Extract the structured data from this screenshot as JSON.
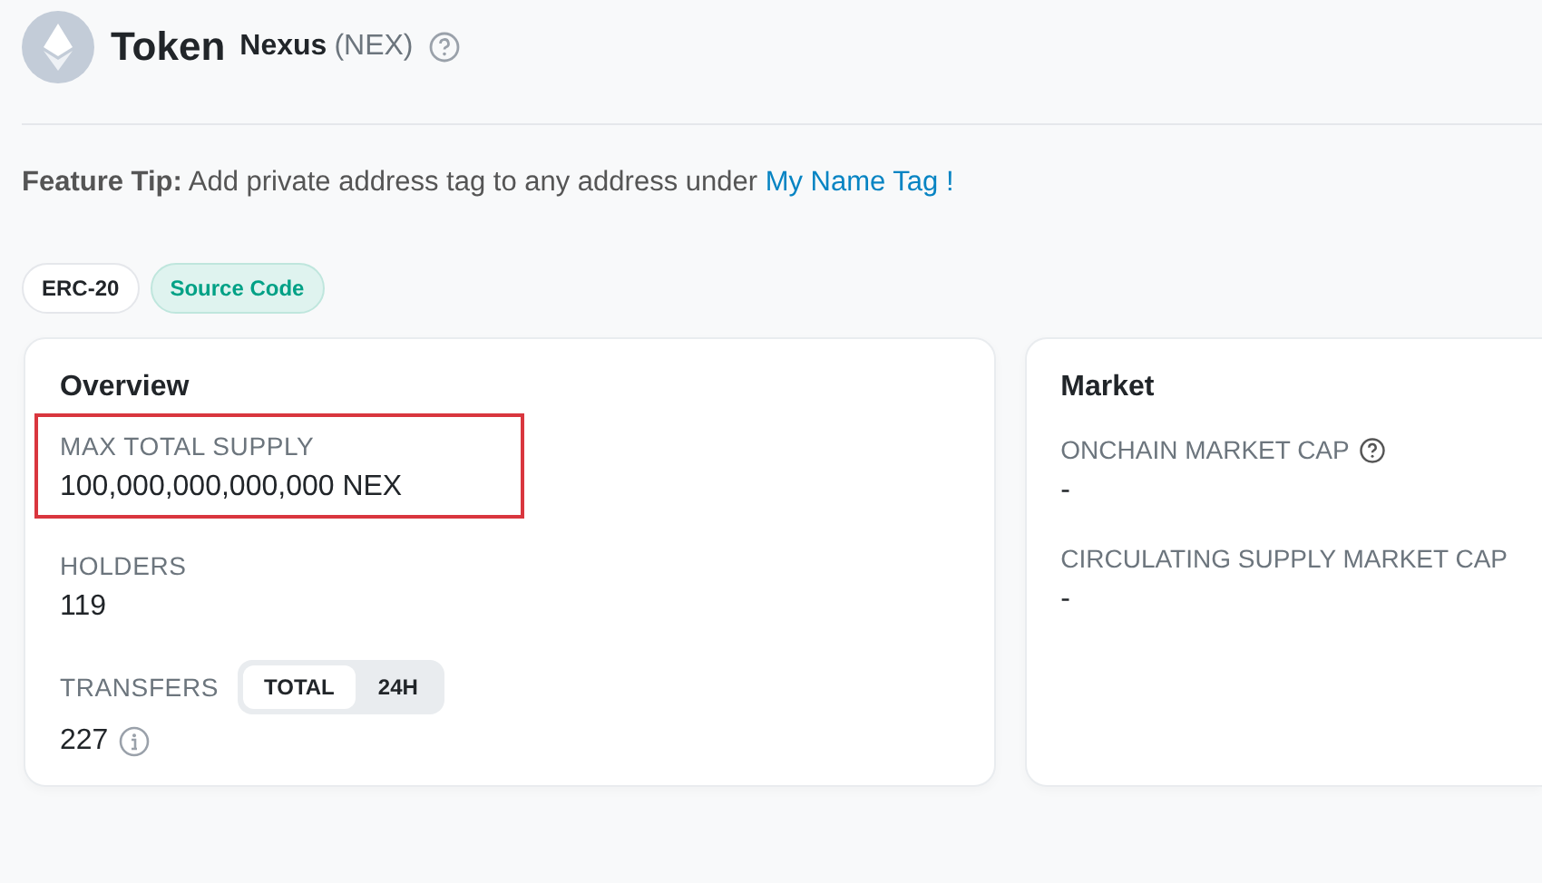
{
  "header": {
    "title": "Token",
    "name": "Nexus",
    "symbol": "(NEX)"
  },
  "feature_tip": {
    "label": "Feature Tip:",
    "text": "Add private address tag to any address under",
    "link": "My Name Tag !"
  },
  "badges": [
    {
      "label": "ERC-20",
      "kind": "plain"
    },
    {
      "label": "Source Code",
      "kind": "verified"
    }
  ],
  "overview": {
    "title": "Overview",
    "fields": [
      {
        "label": "MAX TOTAL SUPPLY",
        "value": "100,000,000,000,000 NEX",
        "highlighted": true
      },
      {
        "label": "HOLDERS",
        "value": "119",
        "highlighted": false
      }
    ],
    "transfers": {
      "label": "TRANSFERS",
      "tabs": [
        {
          "label": "TOTAL",
          "selected": true
        },
        {
          "label": "24H",
          "selected": false
        }
      ],
      "value": "227"
    }
  },
  "market": {
    "title": "Market",
    "fields": [
      {
        "label": "ONCHAIN MARKET CAP",
        "value": "-",
        "help": true
      },
      {
        "label": "CIRCULATING SUPPLY MARKET CAP",
        "value": "-",
        "help": false
      }
    ]
  }
}
